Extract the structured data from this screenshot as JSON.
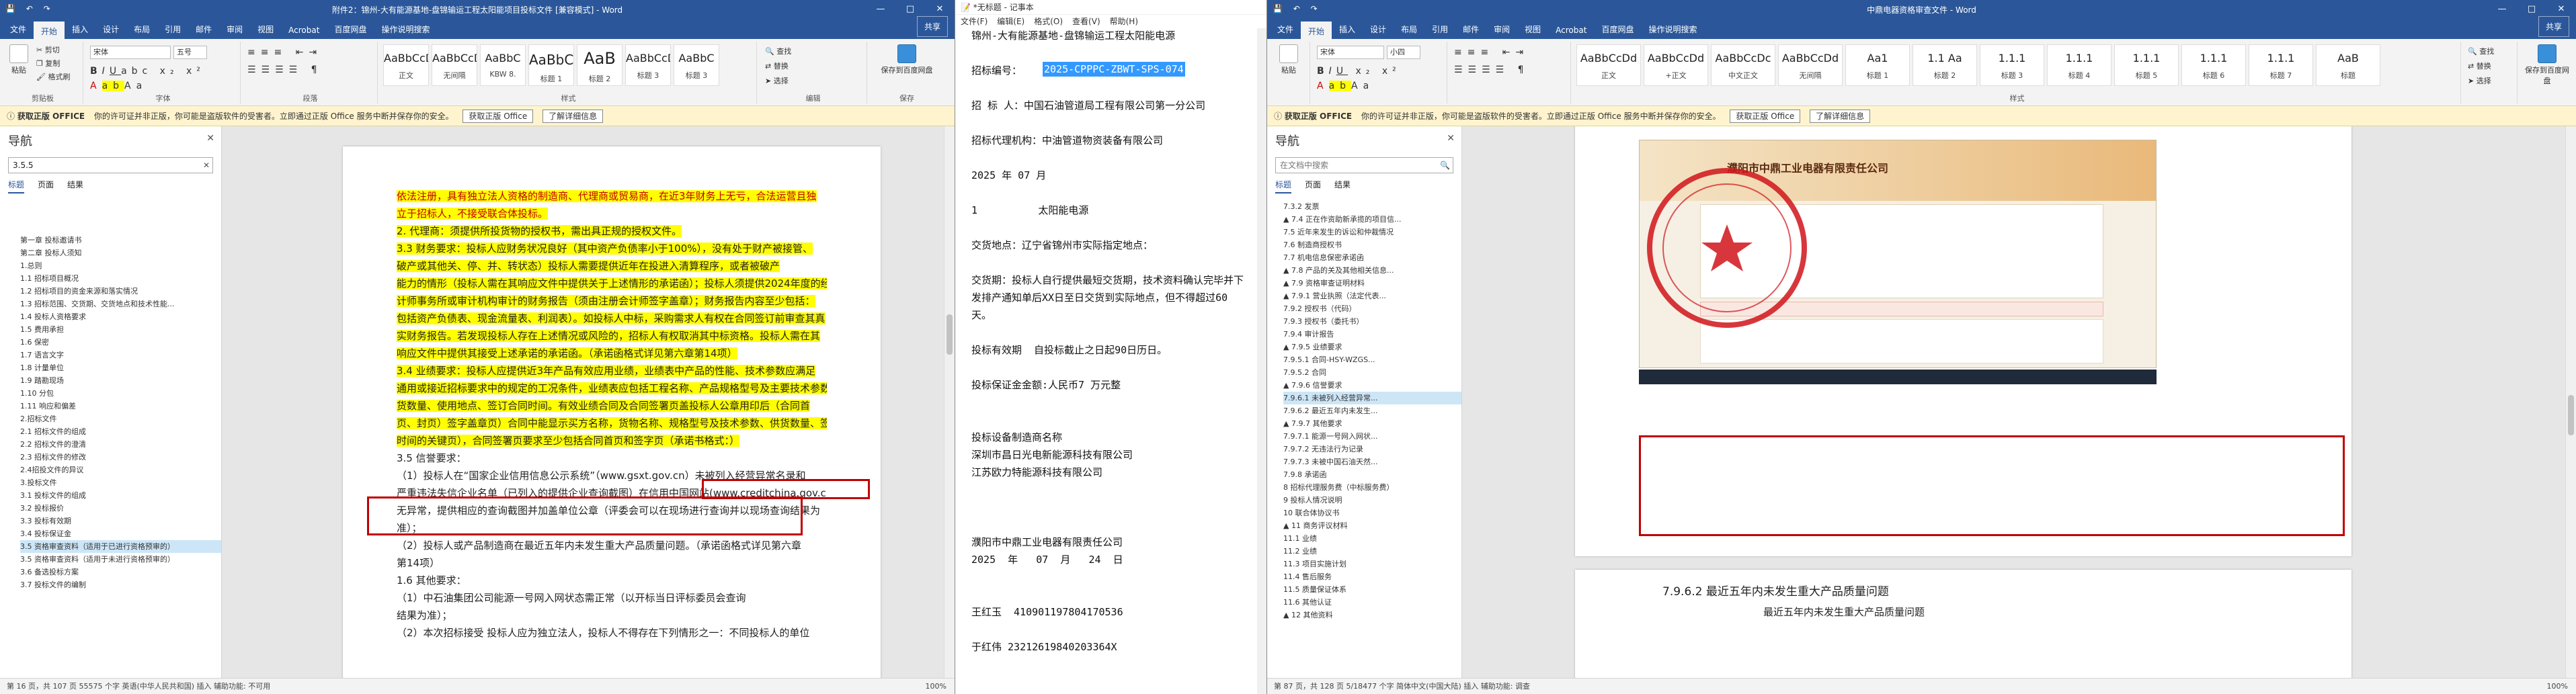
{
  "left_window": {
    "title": "附件2：锦州-大有能源基地-盘锦输运工程太阳能项目投标文件 [兼容模式] - Word",
    "share_label": "共享",
    "tabs": [
      "文件",
      "开始",
      "插入",
      "设计",
      "布局",
      "引用",
      "邮件",
      "审阅",
      "视图",
      "Acrobat",
      "百度网盘",
      "操作说明搜索"
    ],
    "active_tab": "开始",
    "ribbon": {
      "paste": "粘贴",
      "cut": "剪切",
      "copy": "复制",
      "format_painter": "格式刷",
      "clipboard": "剪贴板",
      "font_name": "宋体",
      "font_size": "五号",
      "font_group": "字体",
      "paragraph_group": "段落",
      "styles_group": "样式",
      "styles": [
        {
          "preview": "AaBbCcDd",
          "name": "正文"
        },
        {
          "preview": "AaBbCcDd",
          "name": "无间隔"
        },
        {
          "preview": "AaBbC",
          "name": "KBW 8."
        },
        {
          "preview": "AaBbC",
          "name": "标题 1"
        },
        {
          "preview": "AaB",
          "name": "标题 2"
        },
        {
          "preview": "AaBbCcDd",
          "name": "标题 3"
        },
        {
          "preview": "AaBbC",
          "name": "标题 3"
        }
      ],
      "find": "查找",
      "replace": "替换",
      "select": "选择",
      "edit_group": "编辑",
      "save_baidu": "保存到百度网盘",
      "save_group": "保存"
    },
    "message": {
      "bold": "获取正版 OFFICE",
      "text": "你的许可证并非正版，你可能是盗版软件的受害者。立即通过正版 Office 服务中断并保存你的安全。",
      "btn1": "获取正版 Office",
      "btn2": "了解详细信息"
    },
    "nav": {
      "title": "导航",
      "search": "3.5.5",
      "tabs": [
        "标题",
        "页面",
        "结果"
      ],
      "items": [
        "第一章  投标邀请书",
        "第二章  投标人须知",
        "1.总则",
        "1.1 招标项目概况",
        "1.2 招标项目的资金来源和落实情况",
        "1.3 招标范围、交货期、交货地点和技术性能...",
        "1.4 投标人资格要求",
        "1.5 费用承担",
        "1.6 保密",
        "1.7 语言文字",
        "1.8 计量单位",
        "1.9 踏勘现场",
        "1.10 分包",
        "1.11 响应和偏差",
        "2.招标文件",
        "2.1 招标文件的组成",
        "2.2 招标文件的澄清",
        "2.3 招标文件的修改",
        "2.4招投文件的异议",
        "3.投标文件",
        "3.1 投标文件的组成",
        "3.2 投标报价",
        "3.3 投标有效期",
        "3.4 投标保证金",
        "3.5 资格审查资料（适用于已进行资格预审的）",
        "3.5 资格审查资料（适用于未进行资格预审的）",
        "3.6 备选投标方案",
        "3.7 投标文件的编制"
      ],
      "highlighted_index": 24
    },
    "doc_lines": [
      "依法注册，具有独立法人资格的制造商、代理商或贸易商，在近3年财务上无亏，合法运营且独",
      "立于招标人，不接受联合体投标。",
      "2. 代理商：须提供所投货物的授权书，需出具正规的授权文件。",
      "3.3 财务要求：投标人应财务状况良好（其中资产负债率小于100%），没有处于财产被接管、",
      "破产或其他关、停、并、转状态）投标人需要提供近年在投进入清算程序，或者被破产",
      "能力的情形（投标人需在其响应文件中提供关于上述情形的承诺函）；投标人须提供2024年度的经会",
      "计师事务所或审计机构审计的财务报告（须由注册会计师签字盖章）；财务报告内容至少包括：",
      "包括资产负债表、现金流量表、利润表）。如投标人中标，采购需求人有权在合同签订前审查其真",
      "实财务报告。若发现投标人存在上述情况或风险的，招标人有权取消其中标资格。投标人需在其",
      "响应文件中提供其接受上述承诺的承诺函。（承诺函格式详见第六章第14项）",
      "3.4 业绩要求：投标人应提供近3年产品有效应用业绩，业绩表中产品的性能、技术参数应满足",
      "通用或接近招标要求中的规定的工况条件，业绩表应包括工程名称、产品规格型号及主要技术参数，供",
      "货数量、使用地点、签订合同时间。有效业绩合同及合同签署页盖投标人公章用印后（合同首",
      "页、封页）签字盖章页）合同中能显示买方名称，货物名称、规格型号及技术参数、供货数量、签订",
      "时间的关键页），合同签署页要求至少包括合同首页和签字页（承诺书格式：）",
      "3.5 信誉要求：",
      "（1）投标人在“国家企业信用信息公示系统”（www.gsxt.gov.cn）未被列入经营异常名录和",
      "严重违法失信企业名单（已列入的提供企业查询截图）在信用中国网站(www.creditchina.gov.cn)",
      "无异常，提供相应的查询截图并加盖单位公章（评委会可以在现场进行查询并以现场查询结果为",
      "准）；",
      "（2）投标人或产品制造商在最近五年内未发生重大产品质量问题。（承诺函格式详见第六章",
      "第14项）",
      "1.6 其他要求：",
      "（1）中石油集团公司能源一号网入网状态需正常（以开标当日评标委员会查询",
      "结果为准）；",
      "（2）本次招标接受  投标人应为独立法人，投标人不得存在下列情形之一：不同投标人的单位"
    ],
    "status": {
      "text": "第 16 页，共 107 页    55575 个字    英语(中华人民共和国)    插入    辅助功能: 不可用",
      "zoom": "100%"
    }
  },
  "notepad": {
    "title": "*无标题 - 记事本",
    "menu": [
      "文件(F)",
      "编辑(E)",
      "格式(O)",
      "查看(V)",
      "帮助(H)"
    ],
    "lines": [
      "锦州-大有能源基地-盘锦输运工程太阳能电源",
      "",
      "招标编号：",
      "",
      "招 标 人：中国石油管道局工程有限公司第一分公司",
      "",
      "招标代理机构：中油管道物资装备有限公司",
      "",
      "2025 年 07 月",
      "",
      "1          太阳能电源",
      "",
      "交货地点：辽宁省锦州市实际指定地点：",
      "",
      "交货期：投标人自行提供最短交货期，技术资料确认完毕并下",
      "发排产通知单后XX日至日交货到实际地点，但不得超过60",
      "天。",
      "",
      "投标有效期  自投标截止之日起90日历日。",
      "",
      "投标保证金金额:人民币7 万元整",
      "",
      "",
      "投标设备制造商名称",
      "深圳市昌日光电新能源科技有限公司",
      "江苏欧力特能源科技有限公司",
      "",
      "",
      "",
      "濮阳市中鼎工业电器有限责任公司",
      "2025  年   07  月   24  日",
      "",
      "",
      "王红玉  410901197804170536",
      "",
      "于红伟 23212619840203364X"
    ],
    "selected_code": "2025-CPPPC-ZBWT-SPS-074"
  },
  "right_window": {
    "title": "中鼎电器资格审查文件 - Word",
    "share_label": "共享",
    "tabs": [
      "文件",
      "开始",
      "插入",
      "设计",
      "布局",
      "引用",
      "邮件",
      "审阅",
      "视图",
      "Acrobat",
      "百度网盘",
      "操作说明搜索"
    ],
    "active_tab": "开始",
    "ribbon": {
      "font_name": "宋体",
      "font_size": "小四",
      "styles": [
        {
          "preview": "AaBbCcDd",
          "name": "正文"
        },
        {
          "preview": "AaBbCcDd",
          "name": "+正文"
        },
        {
          "preview": "AaBbCcDc",
          "name": "中文正文"
        },
        {
          "preview": "AaBbCcDd",
          "name": "无间隔"
        },
        {
          "preview": "Aa1",
          "name": "标题 1"
        },
        {
          "preview": "1.1 Aa",
          "name": "标题 2"
        },
        {
          "preview": "1.1.1",
          "name": "标题 3"
        },
        {
          "preview": "1.1.1",
          "name": "标题 4"
        },
        {
          "preview": "1.1.1",
          "name": "标题 5"
        },
        {
          "preview": "1.1.1",
          "name": "标题 6"
        },
        {
          "preview": "1.1.1",
          "name": "标题 7"
        },
        {
          "preview": "AaB",
          "name": "标题"
        }
      ],
      "paste": "粘贴",
      "styles_group": "样式",
      "find": "查找",
      "replace": "替换",
      "select": "选择",
      "save_baidu": "保存到百度网盘"
    },
    "message": {
      "bold": "获取正版 OFFICE",
      "text": "你的许可证并非正版，你可能是盗版软件的受害者。立即通过正版 Office 服务中断并保存你的安全。",
      "btn1": "获取正版 Office",
      "btn2": "了解详细信息"
    },
    "nav": {
      "title": "导航",
      "search": "在文档中搜索",
      "tabs": [
        "标题",
        "页面",
        "结果"
      ],
      "items": [
        "7.3.2 发票",
        "▲ 7.4 正在作资助新承揽的项目信...",
        "7.5 近年来发生的诉讼和仲裁情况",
        "7.6 制造商授权书",
        "7.7 机电信息保密承诺函",
        "▲ 7.8 产品的关及其他相关信息...",
        "▲ 7.9 资格审查证明材料",
        "  ▲ 7.9.1 营业执照（法定代表...",
        "    7.9.2 授权书（代码）",
        "    7.9.3 授权书（委托书）",
        "    7.9.4 审计报告",
        "  ▲ 7.9.5 业绩要求",
        "    7.9.5.1 合同-HSY-WZGS...",
        "    7.9.5.2 合同",
        "  ▲ 7.9.6 信誉要求",
        "    7.9.6.1 未被列入经营异常...",
        "    7.9.6.2 最近五年内未发生...",
        "  ▲ 7.9.7 其他要求",
        "    7.9.7.1 能源一号网入网状...",
        "    7.9.7.2 无违法行为记录",
        "    7.9.7.3 未被中国石油天然...",
        "  7.9.8 承诺函",
        "8 招标代理服务费（中标服务费）",
        "9 投标人情况说明",
        "10 联合体协议书",
        "▲ 11 商务评议材料",
        "  11.1 业绩",
        "  11.2 业绩",
        "  11.3 项目实施计划",
        "  11.4 售后服务",
        "  11.5 质量保证体系",
        "  11.6 其他认证",
        "▲ 12 其他资料"
      ],
      "highlighted_index": 15
    },
    "screenshot_title": "濮阳市中鼎工业电器有限责任公司",
    "section_heading": "7.9.6.2    最近五年内未发生重大产品质量问题",
    "section_sub": "最近五年内未发生重大产品质量问题",
    "status": {
      "text": "第 87 页，共 128 页    5/18477 个字    简体中文(中国大陆)    插入    辅助功能: 调查",
      "zoom": "100%"
    }
  }
}
